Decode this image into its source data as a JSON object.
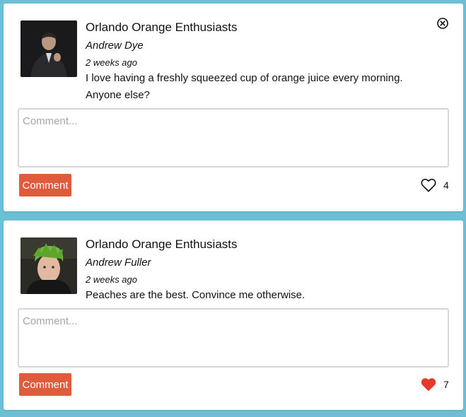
{
  "posts": [
    {
      "group": "Orlando Orange Enthusiasts",
      "author": "Andrew Dye",
      "time": "2 weeks ago",
      "text": "I love having a freshly squeezed cup of orange juice every morning. Anyone else?",
      "comment_placeholder": "Comment...",
      "comment_button": "Comment",
      "likes": "4",
      "liked": false,
      "avatar_icon": "user-photo"
    },
    {
      "group": "Orlando Orange Enthusiasts",
      "author": "Andrew Fuller",
      "time": "2 weeks ago",
      "text": "Peaches are the best. Convince me otherwise.",
      "comment_placeholder": "Comment...",
      "comment_button": "Comment",
      "likes": "7",
      "liked": true,
      "avatar_icon": "user-photo"
    }
  ],
  "icons": {
    "close": "close-circle-icon",
    "heart_outline": "heart-outline-icon",
    "heart_filled": "heart-filled-icon"
  },
  "colors": {
    "background": "#6cc0d6",
    "card": "#ffffff",
    "button": "#e05a3c",
    "heart_filled": "#e6392b"
  }
}
